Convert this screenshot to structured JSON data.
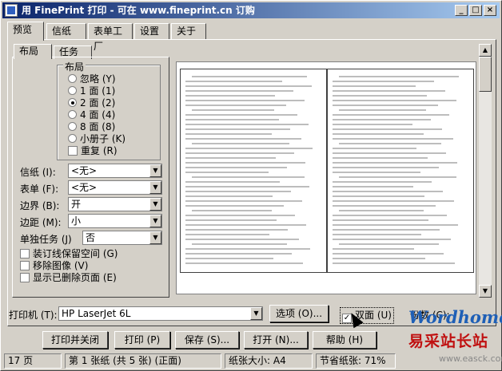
{
  "window": {
    "title": "用 FinePrint 打印 - 可在 www.fineprint.cn 订购",
    "min": "_",
    "max": "□",
    "close": "×"
  },
  "tabs": [
    {
      "label": "预览"
    },
    {
      "label": "信纸"
    },
    {
      "label": "表单工厂"
    },
    {
      "label": "设置"
    },
    {
      "label": "关于"
    }
  ],
  "subtabs": [
    {
      "label": "布局"
    },
    {
      "label": "任务"
    }
  ],
  "layout_group": {
    "title": "布局",
    "options": [
      {
        "label": "忽略 (Y)"
      },
      {
        "label": "1 面 (1)"
      },
      {
        "label": "2 面 (2)",
        "selected": true
      },
      {
        "label": "4 面 (4)"
      },
      {
        "label": "8 面 (8)"
      },
      {
        "label": "小册子 (K)"
      }
    ],
    "repeat_label": "重复 (R)"
  },
  "fields": {
    "stationery": {
      "label": "信纸 (I):",
      "value": "<无>"
    },
    "form": {
      "label": "表单 (F):",
      "value": "<无>"
    },
    "border": {
      "label": "边界 (B):",
      "value": "开"
    },
    "margin": {
      "label": "边距 (M):",
      "value": "小"
    },
    "single_job": {
      "label": "单独任务 (J)",
      "value": "否"
    }
  },
  "checks": {
    "gutter": "装订线保留空间 (G)",
    "remove_images": "移除图像 (V)",
    "show_deleted": "显示已删除页面 (E)"
  },
  "printer": {
    "label": "打印机 (T):",
    "value": "HP LaserJet 6L",
    "options_button": "选项 (O)...",
    "duplex_label": "双面 (U)",
    "copies_label": "份数 (C):"
  },
  "buttons": {
    "print_close": "打印并关闭",
    "print": "打印 (P)",
    "save": "保存 (S)...",
    "open": "打开 (N)...",
    "help": "帮助 (H)"
  },
  "status": {
    "pages": "17 页",
    "sheet": "第 1 张纸 (共 5 张) (正面)",
    "paper_size": "纸张大小: A4",
    "savings": "节省纸张: 71%"
  },
  "watermark": {
    "brand": "Wordhome",
    "site_cn": "易采站长站",
    "site": "www.easck.com"
  }
}
